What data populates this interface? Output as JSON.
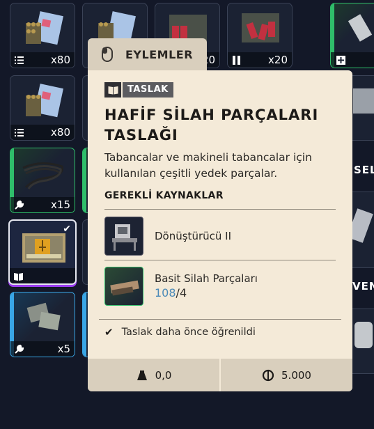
{
  "inventory": {
    "slots": [
      {
        "count": "x80",
        "rarity": "common",
        "footer_icon": "list-icon",
        "art": "ammo-box"
      },
      {
        "count": "",
        "rarity": "common",
        "footer_icon": "",
        "art": "ammo-box"
      },
      {
        "count": "20",
        "rarity": "common",
        "footer_icon": "",
        "art": "shell-box"
      },
      {
        "count": "x20",
        "rarity": "common",
        "footer_icon": "shells-icon",
        "art": "shell-box"
      },
      {
        "count": "x80",
        "rarity": "common",
        "footer_icon": "list-icon",
        "art": "ammo-box"
      },
      {
        "count": "x15",
        "rarity": "uncommon",
        "footer_icon": "wrench-icon",
        "art": "wires"
      },
      {
        "count": "",
        "rarity": "epic",
        "footer_icon": "book-icon",
        "art": "blueprint-case",
        "checked": true
      },
      {
        "count": "x5",
        "rarity": "rare",
        "footer_icon": "wrench-icon",
        "art": "metal-plates"
      }
    ],
    "side_labels": [
      "SELT",
      "VENL"
    ]
  },
  "tooltip": {
    "tab_label": "EYLEMLER",
    "badge": "TASLAK",
    "title": "HAFİF SİLAH PARÇALARI TASLAĞI",
    "description": "Tabancalar ve makineli tabancalar için kullanılan çeşitli yedek parçalar.",
    "required_header": "GEREKLİ KAYNAKLAR",
    "resources": [
      {
        "name": "Dönüştürücü II",
        "icon": "workbench-icon"
      },
      {
        "name": "Basit Silah Parçaları",
        "have": "108",
        "need": "4",
        "icon": "gun-parts-icon"
      }
    ],
    "learned_text": "Taslak daha önce öğrenildi",
    "weight": "0,0",
    "price": "5.000"
  },
  "colors": {
    "panel_bg": "#f4ead8",
    "footer_bg": "#d9cfbd",
    "have_count": "#4a8ab8",
    "uncommon": "#2fbe6a",
    "rare": "#39a6e6",
    "epic": "#9a3df0"
  }
}
